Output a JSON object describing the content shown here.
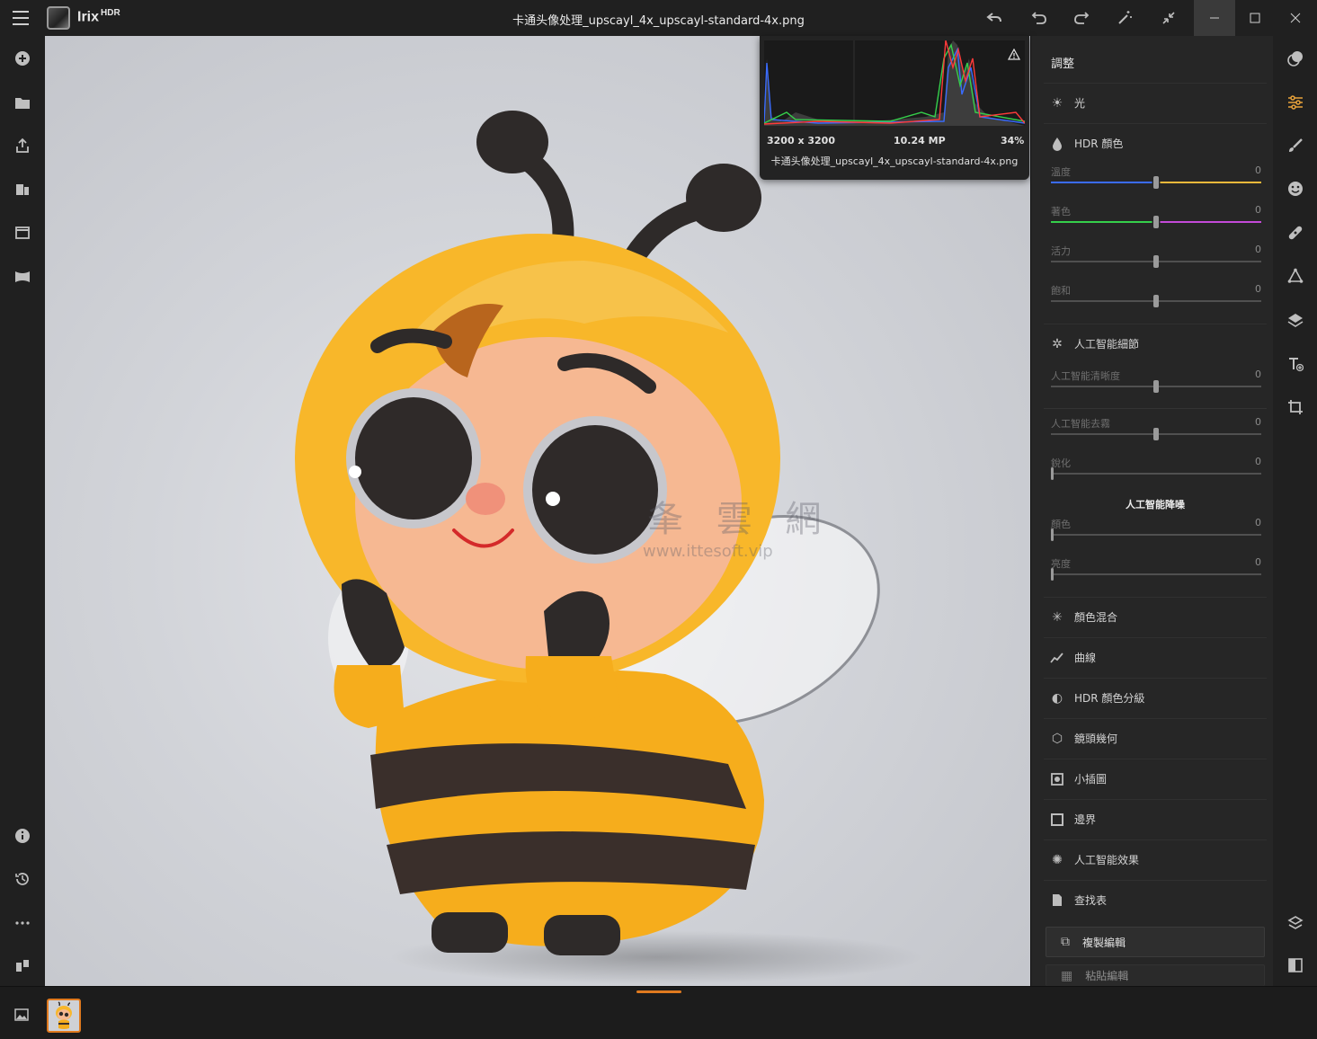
{
  "titlebar": {
    "app_name": "Irix",
    "app_suffix": "HDR",
    "file_name": "卡通头像处理_upscayl_4x_upscayl-standard-4x.png"
  },
  "histogram": {
    "dimensions": "3200 x 3200",
    "megapixels": "10.24 MP",
    "zoom": "34%",
    "file_name": "卡通头像处理_upscayl_4x_upscayl-standard-4x.png"
  },
  "watermark": {
    "text": "夆 雲 網",
    "url": "www.ittesoft.vip"
  },
  "panel": {
    "title": "調整",
    "light": "光",
    "hdr_color": "HDR 顏色",
    "sliders_color": [
      {
        "name": "溫度",
        "value": "0"
      },
      {
        "name": "著色",
        "value": "0"
      },
      {
        "name": "活力",
        "value": "0"
      },
      {
        "name": "飽和",
        "value": "0"
      }
    ],
    "ai_detail": "人工智能細節",
    "sliders_ai": [
      {
        "name": "人工智能清晰度",
        "value": "0"
      },
      {
        "name": "人工智能去霧",
        "value": "0"
      },
      {
        "name": "銳化",
        "value": "0"
      }
    ],
    "ai_denoise": "人工智能降噪",
    "sliders_denoise": [
      {
        "name": "顏色",
        "value": "0"
      },
      {
        "name": "亮度",
        "value": "0"
      }
    ],
    "sections": [
      {
        "label": "顏色混合",
        "icon": "sparkle-icon"
      },
      {
        "label": "曲線",
        "icon": "curve-icon"
      },
      {
        "label": "HDR 顏色分級",
        "icon": "color-grade-icon"
      },
      {
        "label": "鏡頭幾何",
        "icon": "lens-icon"
      },
      {
        "label": "小插圖",
        "icon": "vignette-icon"
      },
      {
        "label": "邊界",
        "icon": "border-icon"
      },
      {
        "label": "人工智能效果",
        "icon": "ai-effect-icon"
      },
      {
        "label": "查找表",
        "icon": "lut-icon"
      }
    ],
    "copy_button": "複製編輯",
    "paste_button": "粘貼編輯"
  }
}
